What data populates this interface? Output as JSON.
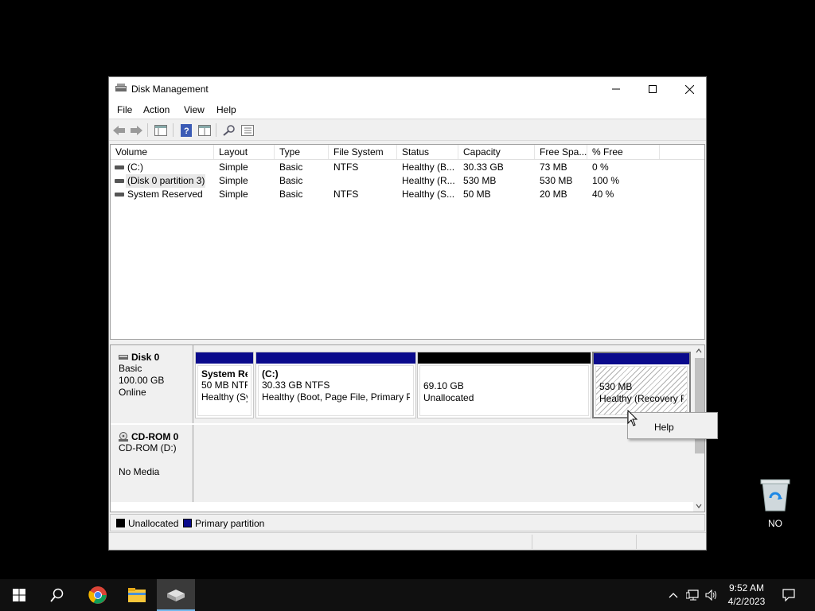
{
  "window": {
    "title": "Disk Management"
  },
  "menu": [
    "File",
    "Action",
    "View",
    "Help"
  ],
  "columns": [
    "Volume",
    "Layout",
    "Type",
    "File System",
    "Status",
    "Capacity",
    "Free Spa...",
    "% Free"
  ],
  "volumes": [
    {
      "volume": "(C:)",
      "layout": "Simple",
      "type": "Basic",
      "fs": "NTFS",
      "status": "Healthy (B...",
      "capacity": "30.33 GB",
      "free": "73 MB",
      "pct": "0 %"
    },
    {
      "volume": "(Disk 0 partition 3)",
      "layout": "Simple",
      "type": "Basic",
      "fs": "",
      "status": "Healthy (R...",
      "capacity": "530 MB",
      "free": "530 MB",
      "pct": "100 %"
    },
    {
      "volume": "System Reserved",
      "layout": "Simple",
      "type": "Basic",
      "fs": "NTFS",
      "status": "Healthy (S...",
      "capacity": "50 MB",
      "free": "20 MB",
      "pct": "40 %"
    }
  ],
  "disk0": {
    "name": "Disk 0",
    "type": "Basic",
    "size": "100.00 GB",
    "state": "Online",
    "partitions": [
      {
        "title": "System Res",
        "size": "50 MB NTFS",
        "status": "Healthy (Sy"
      },
      {
        "title": "(C:)",
        "size": "30.33 GB NTFS",
        "status": "Healthy (Boot, Page File, Primary Pa"
      },
      {
        "title": "",
        "size": "69.10 GB",
        "status": "Unallocated"
      },
      {
        "title": "",
        "size": "530 MB",
        "status": "Healthy (Recovery Pa"
      }
    ]
  },
  "cdrom": {
    "name": "CD-ROM 0",
    "drive": "CD-ROM (D:)",
    "media": "No Media"
  },
  "legend": [
    "Unallocated",
    "Primary partition"
  ],
  "context_menu": [
    "Help"
  ],
  "desktop": {
    "recycle_label": "NO"
  },
  "clock": {
    "time": "9:52 AM",
    "date": "4/2/2023"
  },
  "colors": {
    "primary_partition": "#0a0a8c",
    "unallocated": "#000000",
    "taskbar": "#101010"
  }
}
